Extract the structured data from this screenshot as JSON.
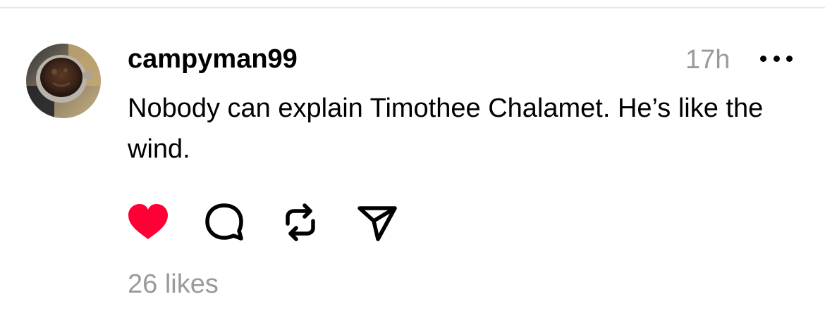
{
  "post": {
    "username": "campyman99",
    "timestamp": "17h",
    "text": "Nobody can explain Timothee Chalamet. He’s like the wind.",
    "liked": true,
    "likes_label": "26 likes"
  },
  "icons": {
    "avatar": "avatar-photo",
    "more": "more-horizontal-icon",
    "like": "heart-filled-icon",
    "comment": "comment-bubble-icon",
    "repost": "repost-icon",
    "share": "send-icon"
  },
  "colors": {
    "like": "#ff0034",
    "muted_text": "#9a9a9a",
    "divider": "#e6e6e6"
  }
}
